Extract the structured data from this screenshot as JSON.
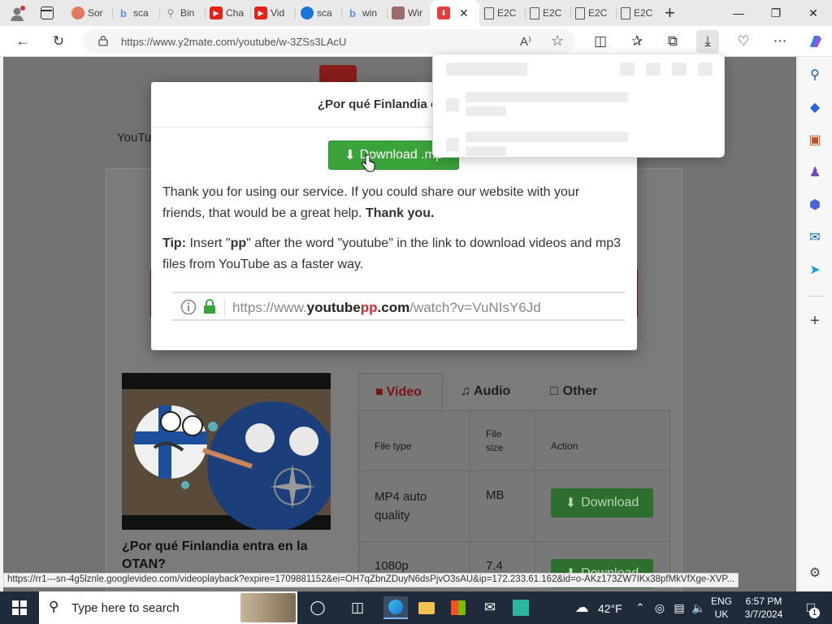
{
  "browser": {
    "tabs": [
      {
        "label": "Sor",
        "favicon": "lion-icon",
        "color": "#e07a5f"
      },
      {
        "label": "sca",
        "favicon": "bing-icon",
        "color": "#5a8dee"
      },
      {
        "label": "Bin",
        "favicon": "search-icon",
        "color": "#8c8c8c"
      },
      {
        "label": "Cha",
        "favicon": "youtube-icon",
        "color": "#e62117"
      },
      {
        "label": "Vid",
        "favicon": "youtube-icon",
        "color": "#e62117"
      },
      {
        "label": "sca",
        "favicon": "edge-icon",
        "color": "#1e73d8"
      },
      {
        "label": "win",
        "favicon": "bing-icon",
        "color": "#5a8dee"
      },
      {
        "label": "Wir",
        "favicon": "grid-icon",
        "color": "#9c6b6b"
      },
      {
        "label": "",
        "favicon": "y2mate-icon",
        "color": "#e53e3e"
      },
      {
        "label": "E2C",
        "favicon": "document-icon",
        "color": "#666666"
      },
      {
        "label": "E2C",
        "favicon": "document-icon",
        "color": "#666666"
      },
      {
        "label": "E2C",
        "favicon": "document-icon",
        "color": "#666666"
      },
      {
        "label": "E2C",
        "favicon": "document-icon",
        "color": "#666666"
      }
    ],
    "new_tab": "+",
    "url": "https://www.y2mate.com/youtube/w-3ZSs3LAcU",
    "read_aloud": "A⁾"
  },
  "page": {
    "nav_label": "YouTub",
    "video_title": "¿Por qué Finlandia entra en la OTAN?",
    "tabs": {
      "video": "Video",
      "audio": "Audio",
      "other": "Other"
    },
    "table": {
      "headers": [
        "File type",
        "File size",
        "Action"
      ],
      "rows": [
        {
          "type": "MP4 auto quality",
          "size": "MB",
          "action": "Download"
        },
        {
          "type": "1080p",
          "size": "7.4",
          "action": "Download"
        }
      ]
    }
  },
  "modal": {
    "title": "¿Por qué Finlandia entra e",
    "download_label": "Download .mp",
    "thanks_text": "Thank you for using our service. If you could share our website with your friends, that would be a great help.",
    "thanks_bold": "Thank you.",
    "tip_label": "Tip:",
    "tip_text_a": "Insert \"",
    "tip_pp": "pp",
    "tip_text_b": "\" after the word \"youtube\" in the link to download videos and mp3 files from YouTube as a faster way.",
    "example_url_a": "https://www.",
    "example_url_b": "youtube",
    "example_url_pp": "pp",
    "example_url_c": ".com",
    "example_url_d": "/watch?v=VuNIsY6Jd"
  },
  "status_url": "https://rr1---sn-4g5lznle.googlevideo.com/videoplayback?expire=1709881152&ei=OH7qZbnZDuyN6dsPjvO3sAU&ip=172.233.61.162&id=o-AKz173ZW7IKx38pfMkVfXge-XVP...",
  "taskbar": {
    "search_placeholder": "Type here to search",
    "weather": "42°F",
    "lang_top": "ENG",
    "lang_bottom": "UK",
    "time": "6:57 PM",
    "date": "3/7/2024",
    "notifications": "1"
  },
  "colors": {
    "accent_red": "#c0392b",
    "download_green": "#3aa33a",
    "taskbar_bg": "#1f2b3a"
  }
}
